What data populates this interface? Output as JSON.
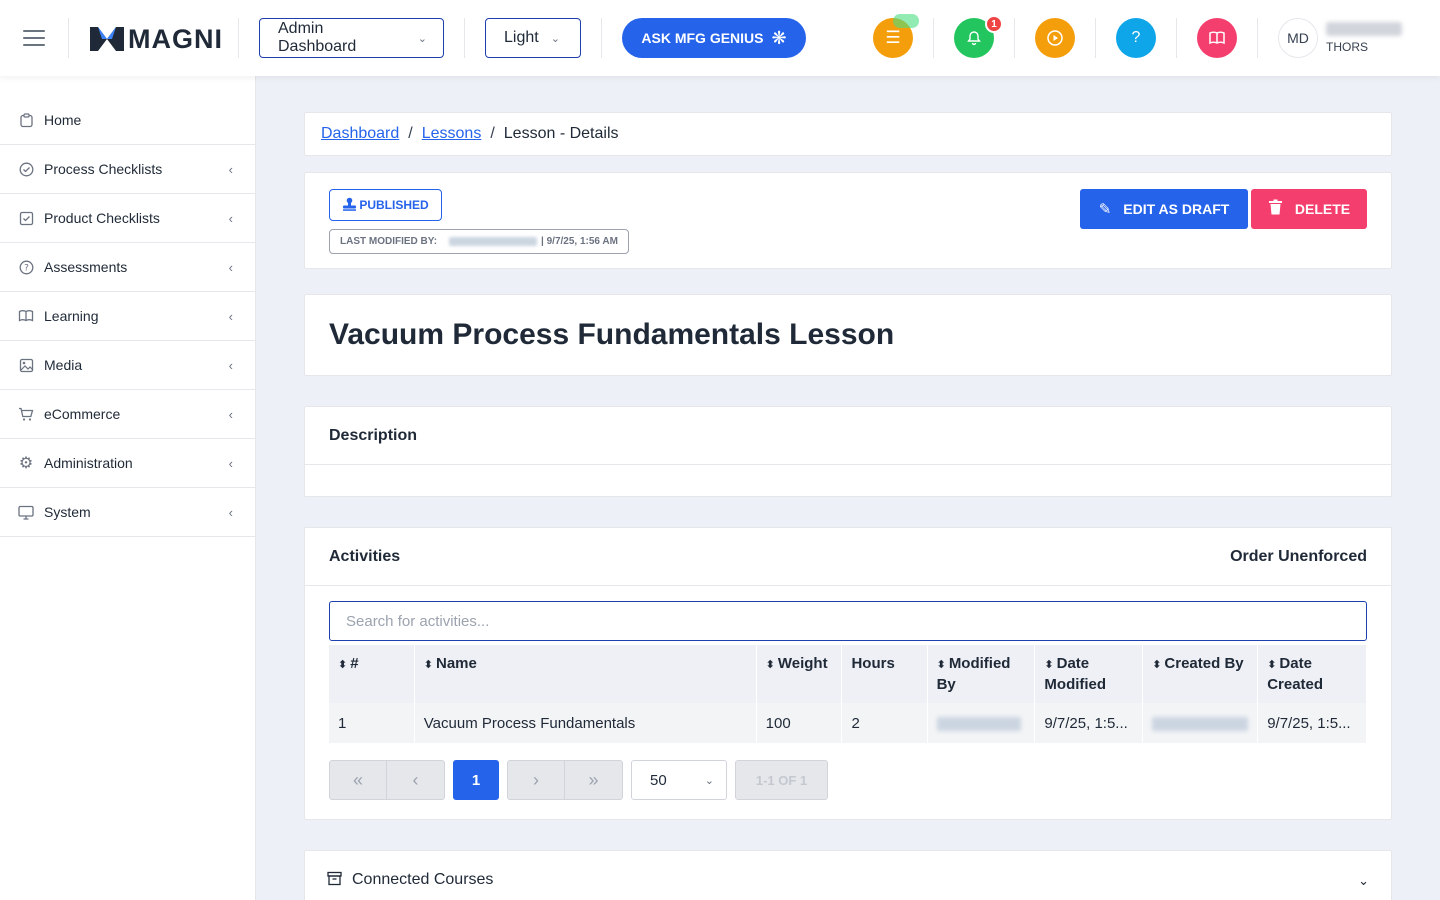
{
  "header": {
    "logo_text": "MAGNI",
    "dashboard_select": "Admin Dashboard",
    "theme_select": "Light",
    "ask_button": "ASK MFG GENIUS",
    "notification_count": "1",
    "avatar_initials": "MD",
    "user_org": "THORS"
  },
  "sidebar": {
    "items": [
      {
        "label": "Home",
        "icon": "clipboard-icon"
      },
      {
        "label": "Process Checklists",
        "icon": "check-circle-icon"
      },
      {
        "label": "Product Checklists",
        "icon": "check-square-icon"
      },
      {
        "label": "Assessments",
        "icon": "question-circle-icon"
      },
      {
        "label": "Learning",
        "icon": "book-icon"
      },
      {
        "label": "Media",
        "icon": "image-icon"
      },
      {
        "label": "eCommerce",
        "icon": "cart-icon"
      },
      {
        "label": "Administration",
        "icon": "gear-icon"
      },
      {
        "label": "System",
        "icon": "monitor-icon"
      }
    ]
  },
  "breadcrumb": {
    "items": [
      "Dashboard",
      "Lessons",
      "Lesson - Details"
    ]
  },
  "status": {
    "badge": "PUBLISHED",
    "modified_label": "LAST MODIFIED BY:",
    "modified_date": "| 9/7/25, 1:56 AM",
    "edit_button": "EDIT AS DRAFT",
    "delete_button": "DELETE"
  },
  "lesson": {
    "title": "Vacuum Process Fundamentals Lesson"
  },
  "description": {
    "heading": "Description"
  },
  "activities": {
    "heading": "Activities",
    "order": "Order Unenforced",
    "search_placeholder": "Search for activities...",
    "columns": [
      "#",
      "Name",
      "Weight",
      "Hours",
      "Modified By",
      "Date Modified",
      "Created By",
      "Date Created"
    ],
    "rows": [
      {
        "num": "1",
        "name": "Vacuum Process Fundamentals",
        "weight": "100",
        "hours": "2",
        "date_modified": "9/7/25, 1:5...",
        "date_created": "9/7/25, 1:5..."
      }
    ],
    "pagination": {
      "first": "«",
      "prev": "‹",
      "current": "1",
      "next": "›",
      "last": "»",
      "per_page": "50",
      "range": "1-1 OF 1"
    }
  },
  "connected_courses": {
    "heading": "Connected Courses"
  },
  "colors": {
    "primary": "#2563eb",
    "danger": "#f43f6e",
    "coins": "#f59e0b",
    "bell": "#22c55e",
    "play": "#f59e0b",
    "help": "#0ea5e9",
    "book": "#f43f6e"
  }
}
